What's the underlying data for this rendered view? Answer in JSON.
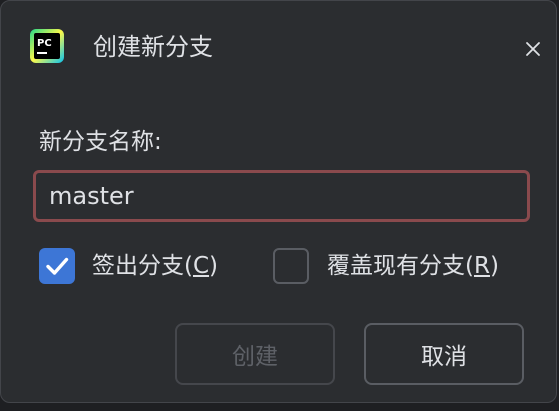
{
  "dialog": {
    "title": "创建新分支",
    "app_icon": "pycharm-icon",
    "app_icon_text": "PC",
    "close_icon": "close-icon"
  },
  "form": {
    "branch_name_label": "新分支名称:",
    "branch_name_value": "master",
    "input_border_color": "#8a4a4d"
  },
  "options": {
    "checkout": {
      "label_prefix": "签出分支(",
      "mnemonic": "C",
      "label_suffix": ")",
      "checked": true
    },
    "overwrite": {
      "label_prefix": "覆盖现有分支(",
      "mnemonic": "R",
      "label_suffix": ")",
      "checked": false
    }
  },
  "buttons": {
    "create_label": "创建",
    "create_enabled": false,
    "cancel_label": "取消"
  },
  "colors": {
    "accent": "#3d76d6",
    "background": "#2b2d30",
    "text": "#dfe1e5"
  }
}
